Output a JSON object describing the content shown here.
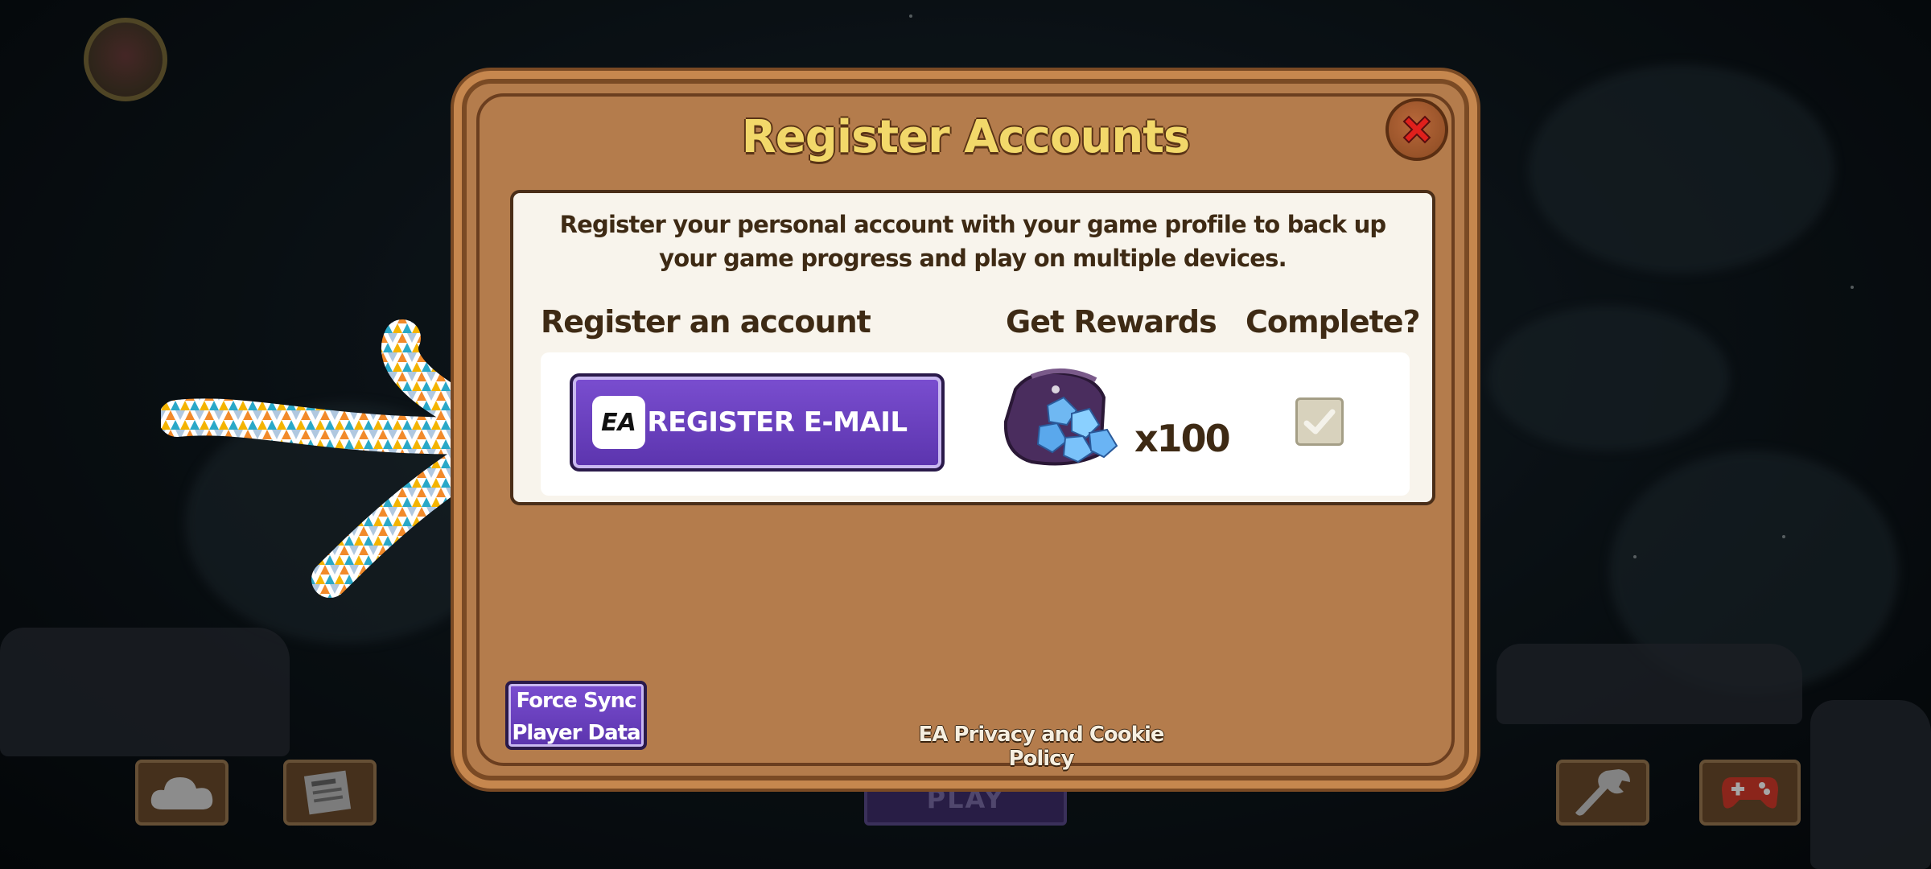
{
  "dialog": {
    "title": "Register Accounts",
    "description": "Register your personal account with your game profile to back up your game progress and play on multiple devices.",
    "columns": {
      "register": "Register an account",
      "rewards": "Get Rewards",
      "complete": "Complete?"
    },
    "register_button": {
      "logo_text": "EA",
      "label": "REGISTER E-MAIL"
    },
    "reward": {
      "icon": "gem-bag-icon",
      "quantity": "x100"
    },
    "complete_checked": true,
    "force_sync_line1": "Force Sync",
    "force_sync_line2": "Player Data",
    "privacy_link": "EA Privacy and Cookie Policy"
  },
  "background": {
    "play_button": "PLAY",
    "left_buttons": [
      "cloud-icon",
      "newspaper-icon"
    ],
    "right_buttons": [
      "wrench-icon",
      "gamepad-icon"
    ]
  },
  "colors": {
    "dialog_bg": "#b47c4c",
    "title": "#f2d86a",
    "button_purple": "#5b34ad",
    "close_red": "#d81e1e"
  }
}
